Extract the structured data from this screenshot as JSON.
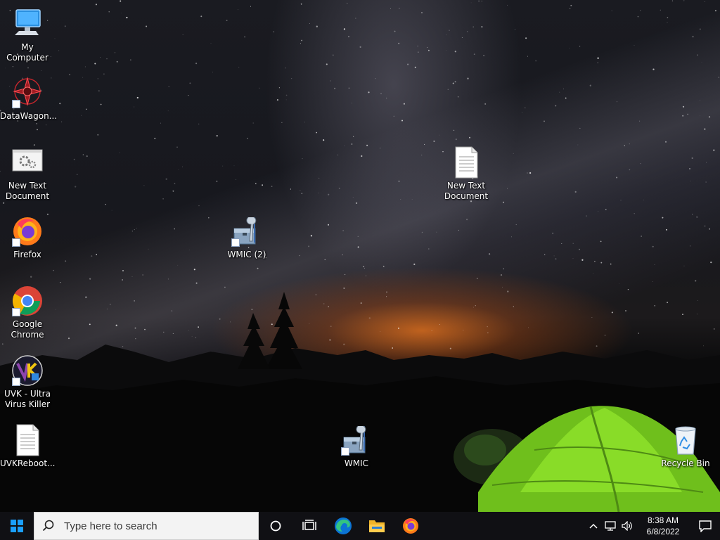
{
  "desktop": {
    "icons": [
      {
        "id": "my-computer",
        "label": "My Computer"
      },
      {
        "id": "datawagon",
        "label": "DataWagon..."
      },
      {
        "id": "new-text-doc-left",
        "label": "New Text Document"
      },
      {
        "id": "firefox",
        "label": "Firefox"
      },
      {
        "id": "google-chrome",
        "label": "Google Chrome"
      },
      {
        "id": "uvk",
        "label": "UVK - Ultra Virus Killer"
      },
      {
        "id": "uvkreboot",
        "label": "UVKReboot..."
      },
      {
        "id": "new-text-doc-right",
        "label": "New Text Document"
      },
      {
        "id": "wmic-2",
        "label": "WMIC (2)"
      },
      {
        "id": "wmic",
        "label": "WMIC"
      },
      {
        "id": "recycle-bin",
        "label": "Recycle Bin"
      }
    ]
  },
  "taskbar": {
    "search_placeholder": "Type here to search",
    "pinned": [
      "cortana-icon",
      "task-view-icon",
      "edge-icon",
      "file-explorer-icon",
      "firefox-icon"
    ],
    "clock": {
      "time": "8:38 AM",
      "date": "6/8/2022"
    }
  },
  "colors": {
    "taskbar": "#101014",
    "search_box": "#f3f3f3",
    "start_blue": "#1a9fff",
    "tent_green": "#7ed321"
  }
}
